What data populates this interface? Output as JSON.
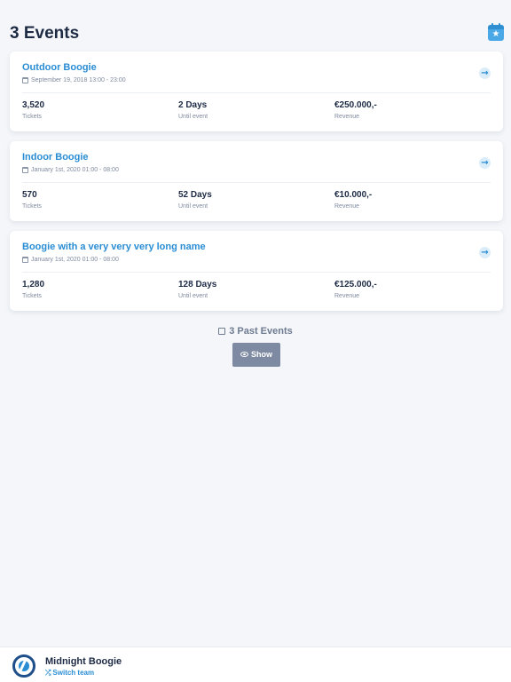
{
  "header": {
    "title": "3 Events",
    "calendar_icon": "calendar-star-icon",
    "calendar_star_glyph": "★"
  },
  "events": [
    {
      "name": "Outdoor Boogie",
      "date": "September 19, 2018 13:00 - 23:00",
      "tickets": "3,520",
      "tickets_label": "Tickets",
      "until": "2 Days",
      "until_label": "Until event",
      "revenue": "€250.000,-",
      "revenue_label": "Revenue",
      "arrow_glyph": "→"
    },
    {
      "name": "Indoor Boogie",
      "date": "January 1st, 2020 01:00 - 08:00",
      "tickets": "570",
      "tickets_label": "Tickets",
      "until": "52 Days",
      "until_label": "Until event",
      "revenue": "€10.000,-",
      "revenue_label": "Revenue",
      "arrow_glyph": "→"
    },
    {
      "name": "Boogie with a very very very long name",
      "date": "January 1st, 2020 01:00 - 08:00",
      "tickets": "1,280",
      "tickets_label": "Tickets",
      "until": "128 Days",
      "until_label": "Until event",
      "revenue": "€125.000,-",
      "revenue_label": "Revenue",
      "arrow_glyph": "→"
    }
  ],
  "past": {
    "label": "3 Past Events",
    "show_label": "Show"
  },
  "footer": {
    "team_name": "Midnight Boogie",
    "switch_label": "Switch team",
    "switch_glyph": "⤮"
  },
  "colors": {
    "accent": "#2a8dd4",
    "text": "#1d2a44",
    "muted": "#7f8aa0",
    "background": "#f4f6f9",
    "button": "#7d8aa1"
  }
}
